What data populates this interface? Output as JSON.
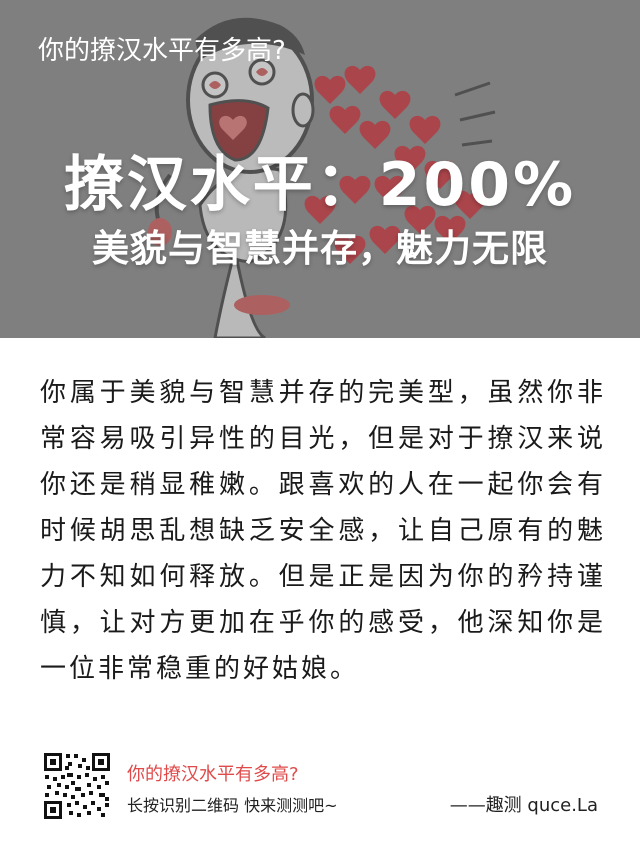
{
  "header": {
    "title": "你的撩汉水平有多高?"
  },
  "result": {
    "score_line": "撩汉水平：200%",
    "tagline": "美貌与智慧并存，魅力无限"
  },
  "description": "你属于美貌与智慧并存的完美型，虽然你非常容易吸引异性的目光，但是对于撩汉来说你还是稍显稚嫩。跟喜欢的人在一起你会有时候胡思乱想缺乏安全感，让自己原有的魅力不知如何释放。但是正是因为你的矜持谨慎，让对方更加在乎你的感受，他深知你是一位非常稳重的好姑娘。",
  "footer": {
    "title": "你的撩汉水平有多高?",
    "hint": "长按识别二维码  快来测测吧~",
    "brand": "——趣测 quce.La"
  },
  "colors": {
    "hero_overlay": "#7f7f7f",
    "accent_red": "#e04a4a",
    "heart_red": "#c8202a"
  },
  "icons": {
    "qr": "qr-code-icon",
    "illustration": "cartoon-character-hearts"
  }
}
